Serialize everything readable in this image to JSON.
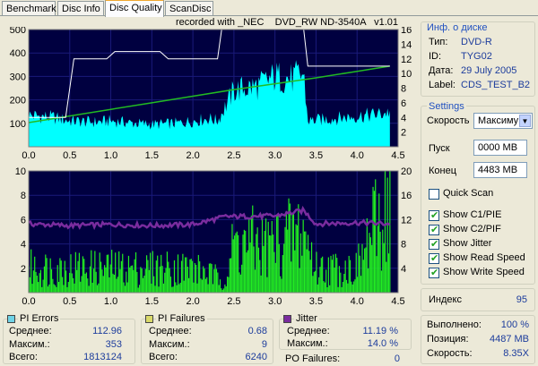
{
  "tabs": [
    {
      "label": "Benchmark",
      "active": false
    },
    {
      "label": "Disc Info",
      "active": false
    },
    {
      "label": "Disc Quality",
      "active": true
    },
    {
      "label": "ScanDisc",
      "active": false
    }
  ],
  "recorded_with": "recorded with _NEC    DVD_RW ND-3540A   v1.01",
  "disc_info": {
    "title": "Инф. о диске",
    "rows": [
      {
        "label": "Тип:",
        "value": "DVD-R"
      },
      {
        "label": "ID:",
        "value": "TYG02"
      },
      {
        "label": "Дата:",
        "value": "29 July 2005"
      },
      {
        "label": "Label:",
        "value": "CDS_TEST_B2"
      }
    ]
  },
  "settings": {
    "title": "Settings",
    "speed_label": "Скорость",
    "speed_value": "Максиму",
    "start_label": "Пуск",
    "start_value": "0000 MB",
    "end_label": "Конец",
    "end_value": "4483 MB",
    "quick_scan": {
      "label": "Quick Scan",
      "checked": false
    },
    "options": [
      {
        "label": "Show C1/PIE",
        "checked": true
      },
      {
        "label": "Show C2/PIF",
        "checked": true
      },
      {
        "label": "Show Jitter",
        "checked": true
      },
      {
        "label": "Show Read Speed",
        "checked": true
      },
      {
        "label": "Show Write Speed",
        "checked": true
      }
    ]
  },
  "index": {
    "label": "Индекс",
    "value": "95"
  },
  "progress": {
    "rows": [
      {
        "label": "Выполнено:",
        "value": "100 %"
      },
      {
        "label": "Позиция:",
        "value": "4487 MB"
      },
      {
        "label": "Скорость:",
        "value": "8.35X"
      }
    ]
  },
  "pi_errors": {
    "title": "PI Errors",
    "color": "#6fd3e6",
    "rows": [
      {
        "label": "Среднее:",
        "value": "112.96"
      },
      {
        "label": "Максим.:",
        "value": "353"
      },
      {
        "label": "Всего:",
        "value": "1813124"
      }
    ]
  },
  "pi_failures": {
    "title": "PI Failures",
    "color": "#d9d96a",
    "rows": [
      {
        "label": "Среднее:",
        "value": "0.68"
      },
      {
        "label": "Максим.:",
        "value": "9"
      },
      {
        "label": "Всего:",
        "value": "6240"
      }
    ]
  },
  "jitter": {
    "title": "Jitter",
    "color": "#7a2c9e",
    "rows": [
      {
        "label": "Среднее:",
        "value": "11.19 %"
      },
      {
        "label": "Максим.:",
        "value": "14.0 %"
      }
    ]
  },
  "po_failures": {
    "label": "PO Failures:",
    "value": "0"
  },
  "chart_data": [
    {
      "type": "area",
      "title": "PI Errors",
      "x_ticks": [
        "0.0",
        "0.5",
        "1.0",
        "1.5",
        "2.0",
        "2.5",
        "3.0",
        "3.5",
        "4.0",
        "4.5"
      ],
      "y_left_ticks": [
        "100",
        "200",
        "300",
        "400",
        "500"
      ],
      "y_right_ticks": [
        "2",
        "4",
        "6",
        "8",
        "10",
        "12",
        "14",
        "16"
      ],
      "xlim": [
        0,
        4.5
      ],
      "ylim": [
        0,
        500
      ],
      "y2lim": [
        0,
        16
      ],
      "series": [
        {
          "name": "PI Errors",
          "color": "#00ffff",
          "x": [
            0,
            0.3,
            0.5,
            0.8,
            1.0,
            1.3,
            1.5,
            1.8,
            2.0,
            2.2,
            2.3,
            2.5,
            2.8,
            3.0,
            3.2,
            3.35,
            3.4,
            3.7,
            4.0,
            4.3,
            4.4
          ],
          "values": [
            135,
            125,
            110,
            105,
            110,
            100,
            95,
            100,
            110,
            120,
            110,
            240,
            260,
            300,
            290,
            310,
            110,
            120,
            130,
            140,
            150
          ]
        },
        {
          "name": "Read Speed",
          "color": "#22bb22",
          "x": [
            0,
            0.5,
            1.0,
            1.5,
            2.0,
            2.5,
            3.0,
            3.5,
            4.0,
            4.4
          ],
          "values": [
            3.3,
            4.2,
            5.1,
            6.0,
            6.9,
            7.8,
            8.6,
            9.4,
            10.3,
            11.0
          ]
        },
        {
          "name": "Write Speed",
          "color": "#ffffff",
          "x": [
            0,
            0.45,
            0.55,
            0.95,
            1.05,
            1.6,
            1.7,
            2.3,
            2.35,
            3.35,
            3.4,
            4.4
          ],
          "values": [
            4,
            4,
            12,
            12,
            13,
            13,
            12,
            12,
            16,
            16,
            11,
            11
          ]
        }
      ]
    },
    {
      "type": "bar",
      "title": "PI Failures / Jitter",
      "x_ticks": [
        "0.0",
        "0.5",
        "1.0",
        "1.5",
        "2.0",
        "2.5",
        "3.0",
        "3.5",
        "4.0",
        "4.5"
      ],
      "y_left_ticks": [
        "2",
        "4",
        "6",
        "8",
        "10"
      ],
      "y_right_ticks": [
        "4",
        "8",
        "12",
        "16",
        "20"
      ],
      "xlim": [
        0,
        4.5
      ],
      "ylim": [
        0,
        10
      ],
      "y2lim": [
        0,
        20
      ],
      "series": [
        {
          "name": "PI Failures",
          "color": "#22ee22",
          "x": [
            0,
            0.5,
            1.0,
            1.5,
            2.0,
            2.4,
            2.5,
            3.0,
            3.35,
            3.5,
            4.0,
            4.4
          ],
          "values": [
            2,
            2,
            2,
            2,
            2,
            1,
            4,
            4,
            5,
            2,
            2,
            8
          ]
        },
        {
          "name": "Jitter",
          "color": "#7a2c9e",
          "x": [
            0,
            0.5,
            1.0,
            1.5,
            2.0,
            2.4,
            2.5,
            3.0,
            3.35,
            3.5,
            4.0,
            4.4
          ],
          "values": [
            11.3,
            11.0,
            11.2,
            11.0,
            11.2,
            12.5,
            12.5,
            12.6,
            13.5,
            11.3,
            11.5,
            11.3
          ]
        }
      ]
    }
  ]
}
